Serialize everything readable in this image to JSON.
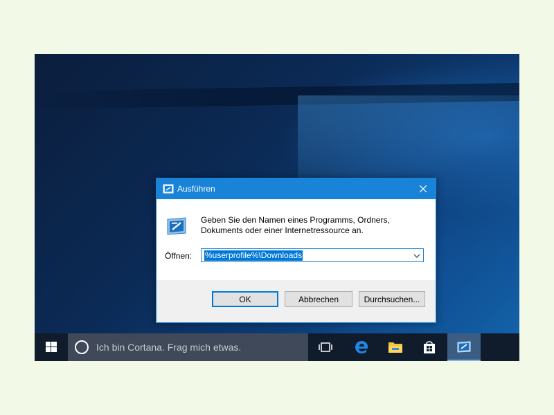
{
  "dialog": {
    "title": "Ausführen",
    "description_line1": "Geben Sie den Namen eines Programms, Ordners,",
    "description_line2": "Dokuments oder einer Internetressource an.",
    "open_label": "Öffnen:",
    "open_value": "%userprofile%\\Downloads",
    "buttons": {
      "ok": "OK",
      "cancel": "Abbrechen",
      "browse": "Durchsuchen..."
    }
  },
  "taskbar": {
    "cortana_placeholder": "Ich bin Cortana. Frag mich etwas.",
    "icons": [
      "windows-start-icon",
      "task-view-icon",
      "edge-icon",
      "file-explorer-icon",
      "store-icon",
      "run-icon"
    ]
  },
  "colors": {
    "accent": "#1883d7",
    "taskbar": "#101b2c",
    "cortana_box": "#3f4959",
    "selection": "#0078d7"
  }
}
